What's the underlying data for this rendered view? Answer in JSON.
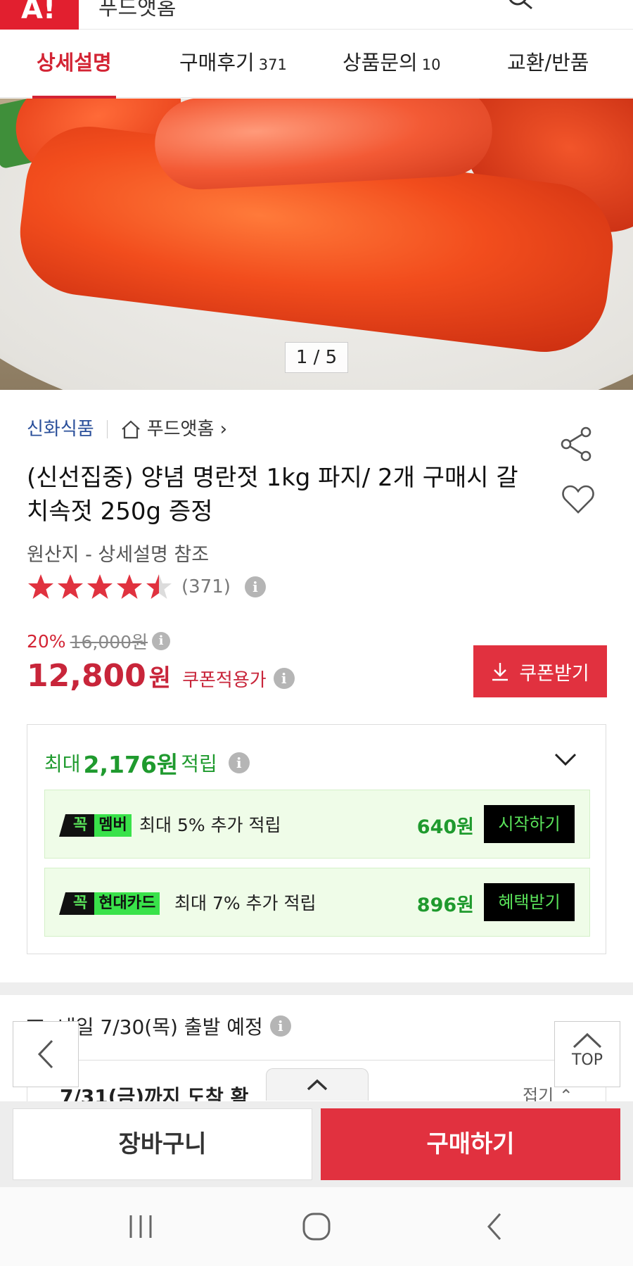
{
  "appbar": {
    "logo": "A!",
    "title": "푸드앳홈"
  },
  "tabs": [
    {
      "label": "상세설명",
      "count": ""
    },
    {
      "label": "구매후기",
      "count": "371"
    },
    {
      "label": "상품문의",
      "count": "10"
    },
    {
      "label": "교환/반품",
      "count": ""
    }
  ],
  "hero": {
    "counter": "1 / 5"
  },
  "product": {
    "brand": "신화식품",
    "store": "푸드앳홈 ›",
    "title": "(신선집중) 양념 명란젓 1kg 파지/ 2개 구매시 갈치속젓 250g 증정",
    "origin": "원산지 - 상세설명 참조",
    "rating_value": 4.5,
    "rating_count": "(371)",
    "discount_rate": "20%",
    "original_price": "16,000원",
    "price": "12,800",
    "price_unit": "원",
    "coupon_price_label": "쿠폰적용가",
    "coupon_button": "쿠폰받기",
    "info_glyph": "i"
  },
  "points": {
    "prefix": "최대",
    "amount": "2,176원",
    "suffix": "적립",
    "benefits": [
      {
        "badge_k": "꼭",
        "badge_t": "멤버",
        "text": "최대 5% 추가 적립",
        "amount": "640원",
        "button": "시작하기"
      },
      {
        "badge_k": "꼭",
        "badge_t": "현대카드",
        "text": "최대 7% 추가 적립",
        "amount": "896원",
        "button": "혜택받기"
      }
    ]
  },
  "shipping": {
    "text": "내일 7/30(목) 출발 예정",
    "arrival": "7/31(금)까지 도착 확",
    "toggle": "접기 ⌃"
  },
  "floating": {
    "top_label": "TOP"
  },
  "actions": {
    "cart": "장바구니",
    "buy": "구매하기"
  },
  "colors": {
    "accent_red": "#e1313f",
    "green": "#1f9a2e",
    "brand_blue": "#2a4f9a"
  }
}
